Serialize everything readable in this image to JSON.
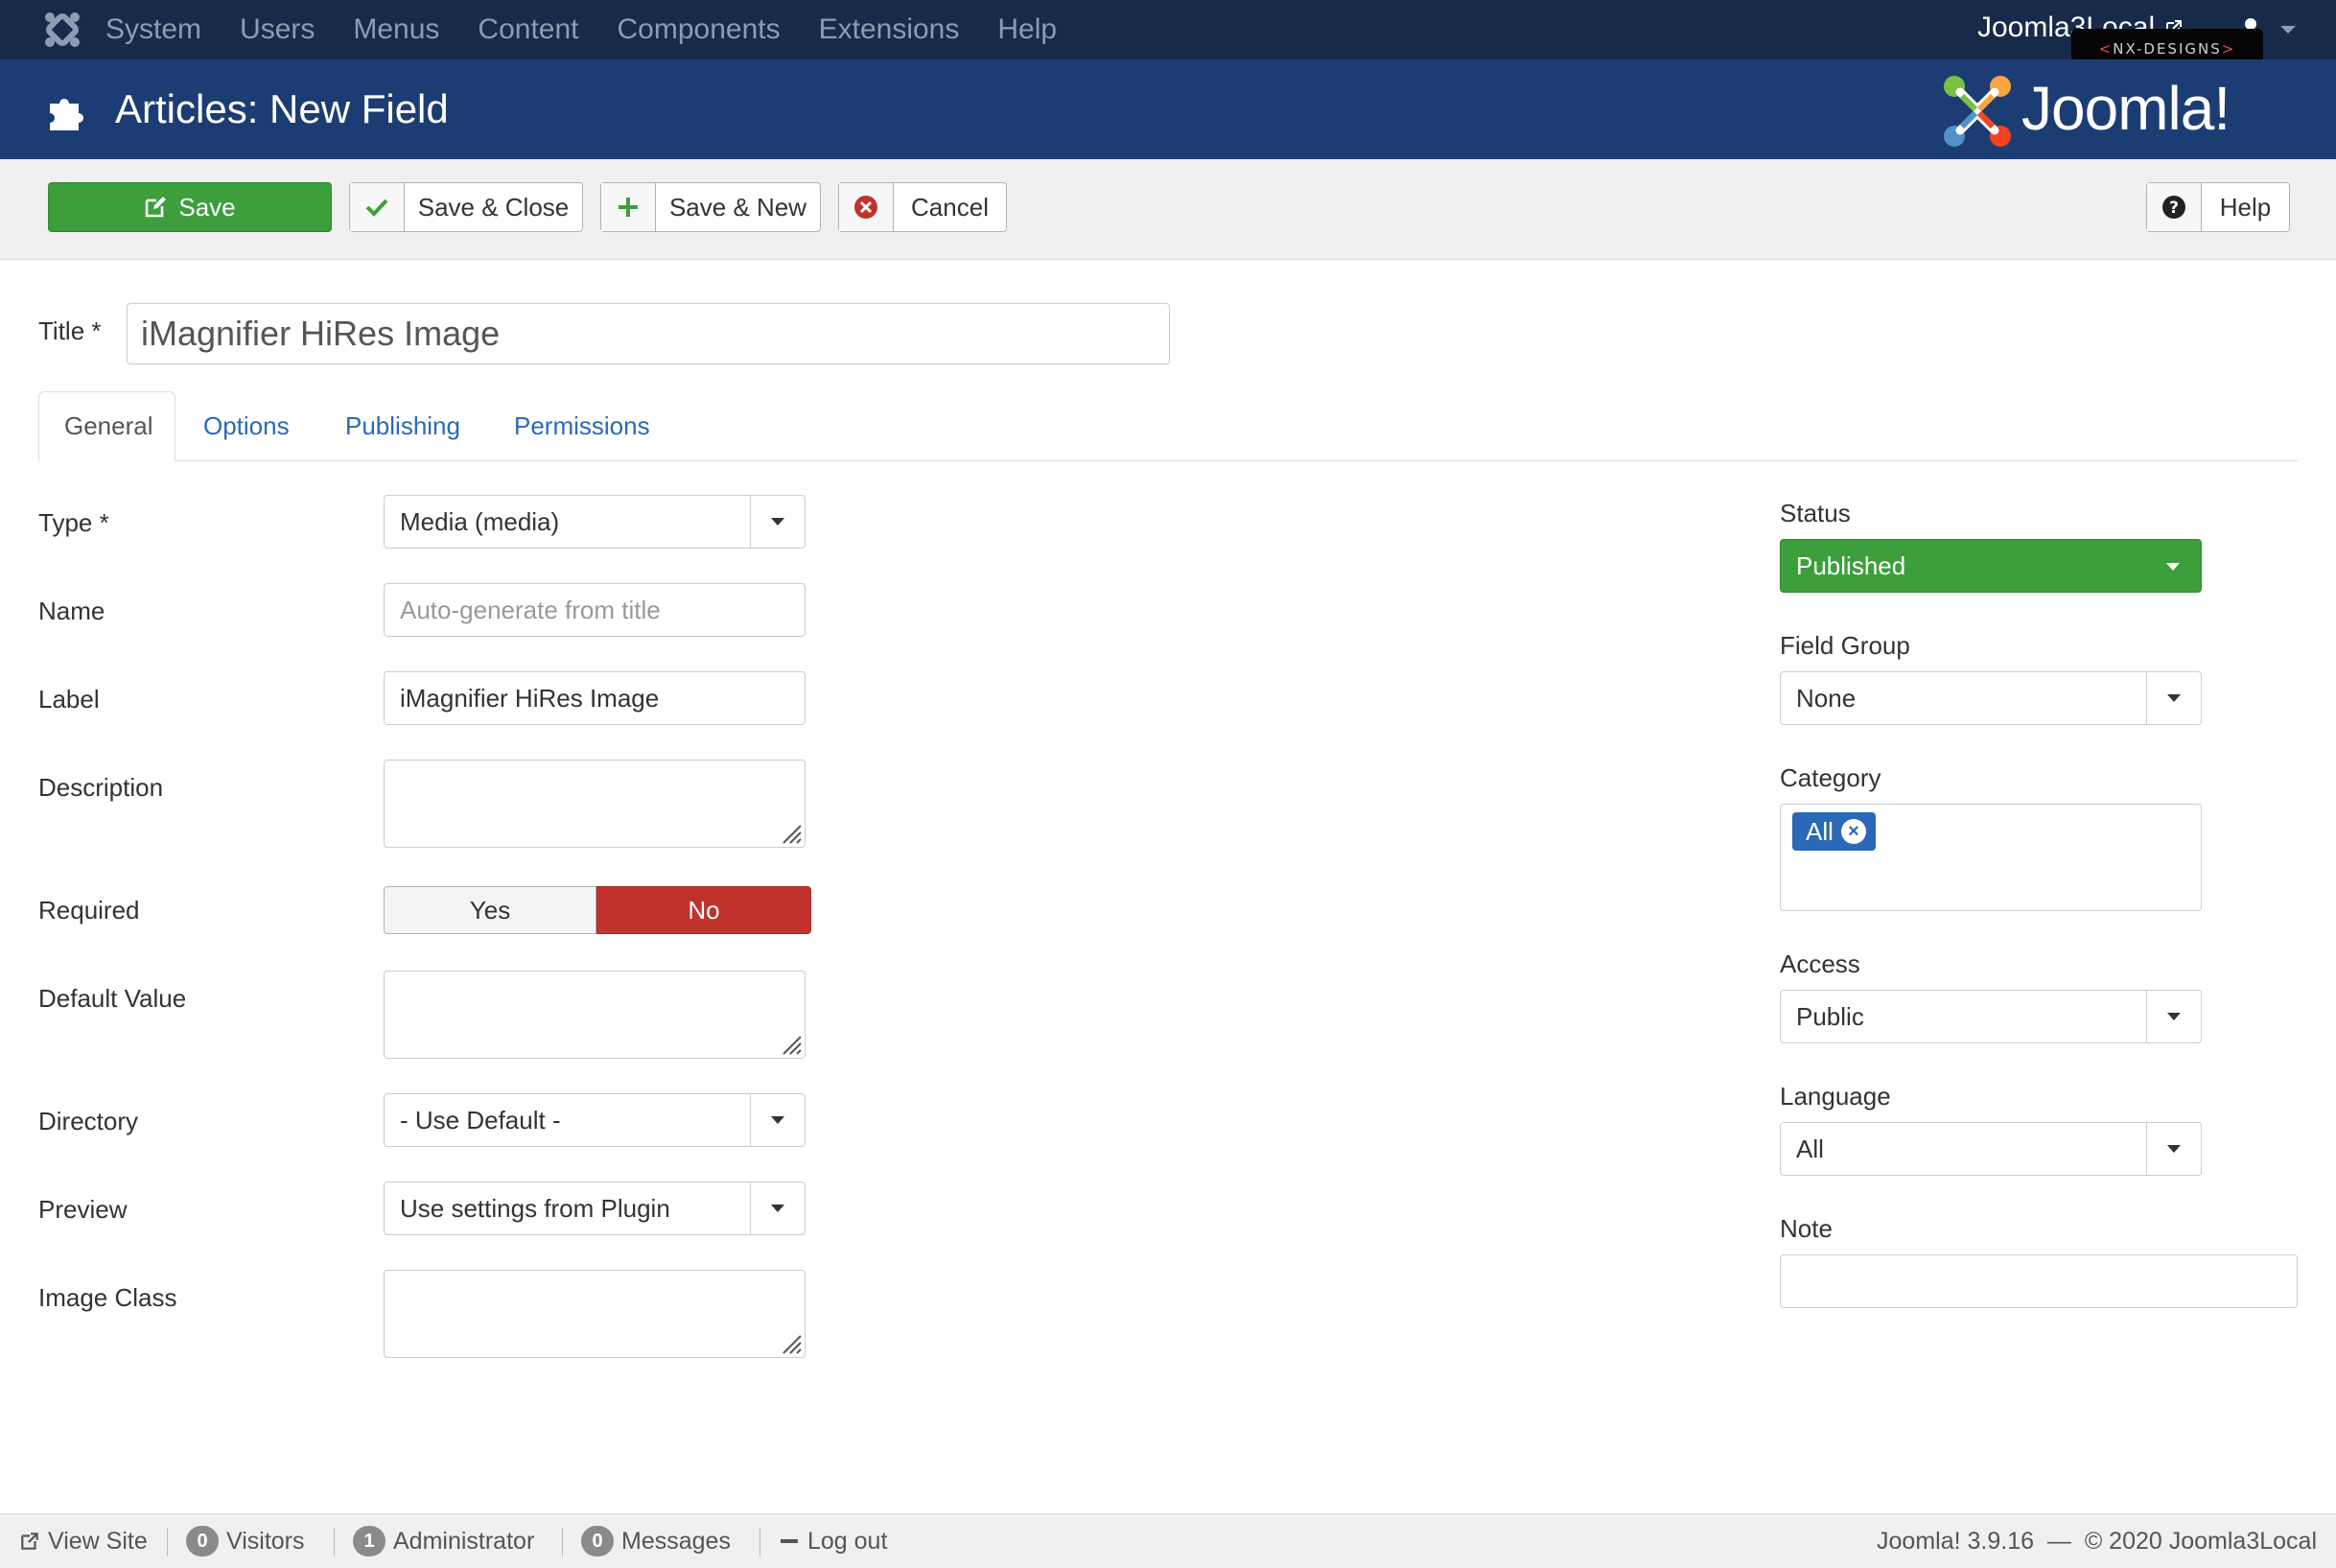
{
  "navbar": {
    "menu": [
      "System",
      "Users",
      "Menus",
      "Content",
      "Components",
      "Extensions",
      "Help"
    ],
    "site_name": "Joomla3Local",
    "badge_text": "NX-DESIGNS"
  },
  "header": {
    "title": "Articles: New Field",
    "brand": "Joomla!"
  },
  "toolbar": {
    "save": "Save",
    "save_close": "Save & Close",
    "save_new": "Save & New",
    "cancel": "Cancel",
    "help": "Help"
  },
  "form": {
    "title_label": "Title *",
    "title_value": "iMagnifier HiRes Image",
    "tabs": [
      "General",
      "Options",
      "Publishing",
      "Permissions"
    ],
    "type": {
      "label": "Type *",
      "value": "Media (media)"
    },
    "name": {
      "label": "Name",
      "placeholder": "Auto-generate from title"
    },
    "field_label": {
      "label": "Label",
      "value": "iMagnifier HiRes Image"
    },
    "description": {
      "label": "Description"
    },
    "required": {
      "label": "Required",
      "yes": "Yes",
      "no": "No",
      "selected": "No"
    },
    "default_value": {
      "label": "Default Value"
    },
    "directory": {
      "label": "Directory",
      "value": "- Use Default -"
    },
    "preview": {
      "label": "Preview",
      "value": "Use settings from Plugin"
    },
    "image_class": {
      "label": "Image Class"
    }
  },
  "sidebar": {
    "status": {
      "label": "Status",
      "value": "Published"
    },
    "field_group": {
      "label": "Field Group",
      "value": "None"
    },
    "category": {
      "label": "Category",
      "chip": "All"
    },
    "access": {
      "label": "Access",
      "value": "Public"
    },
    "language": {
      "label": "Language",
      "value": "All"
    },
    "note": {
      "label": "Note",
      "value": ""
    }
  },
  "statusbar": {
    "view_site": "View Site",
    "visitors_count": "0",
    "visitors": "Visitors",
    "admin_count": "1",
    "admin": "Administrator",
    "messages_count": "0",
    "messages": "Messages",
    "logout": "Log out",
    "version": "Joomla! 3.9.16",
    "copyright": "© 2020 Joomla3Local"
  },
  "colors": {
    "navbar_bg": "#172a4a",
    "header_bg": "#1c3d73",
    "success": "#3c9f3c",
    "danger": "#c0332b",
    "link": "#2a69b8"
  }
}
